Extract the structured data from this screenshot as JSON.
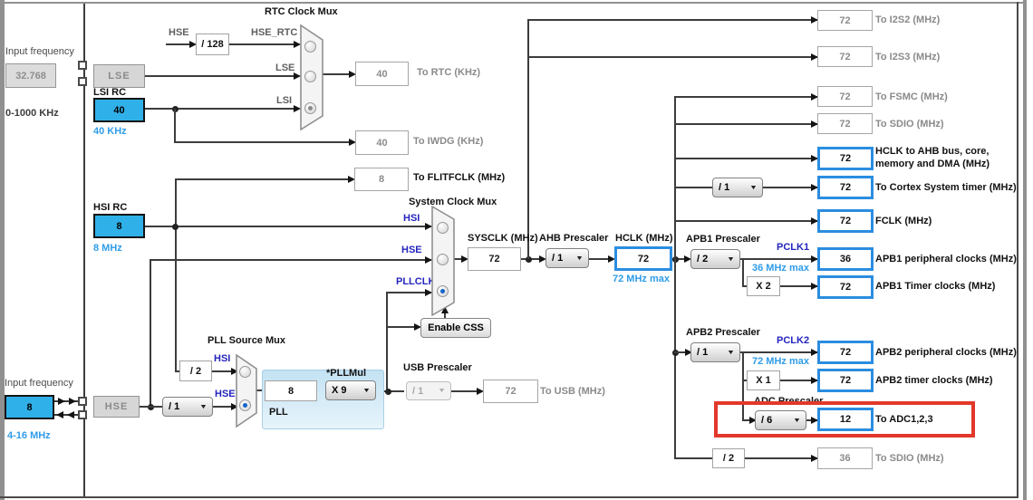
{
  "meta": {
    "caret_icon": "▼",
    "accent_blue": "#2b8de0",
    "cyan_fill": "#30b0e8",
    "highlight_red": "#e2382b"
  },
  "left": {
    "lse_input_label": "Input frequency",
    "lse_input_value": "32.768",
    "lse_input_range": "0-1000 KHz",
    "lse_label": "LSE",
    "lsi_title": "LSI RC",
    "lsi_value": "40",
    "lsi_note": "40 KHz",
    "hsi_title": "HSI RC",
    "hsi_value": "8",
    "hsi_note": "8 MHz",
    "hse_input_label": "Input frequency",
    "hse_input_value": "8",
    "hse_input_range": "4-16 MHz",
    "hse_label": "HSE"
  },
  "rtc": {
    "title": "RTC Clock Mux",
    "hse_tap": "HSE",
    "div128": "/ 128",
    "net_hse_rtc": "HSE_RTC",
    "net_lse": "LSE",
    "net_lsi": "LSI",
    "to_rtc_value": "40",
    "to_rtc_label": "To RTC (KHz)",
    "to_iwdg_value": "40",
    "to_iwdg_label": "To IWDG (KHz)",
    "to_flitf_value": "8",
    "to_flitf_label": "To FLITFCLK (MHz)"
  },
  "sysmux": {
    "title": "System Clock Mux",
    "net_hsi": "HSI",
    "net_hse": "HSE",
    "net_pllclk": "PLLCLK",
    "enable_css": "Enable CSS",
    "sysclk_title": "SYSCLK (MHz)",
    "sysclk_value": "72",
    "ahb_title": "AHB Prescaler",
    "ahb_value": "/ 1",
    "hclk_title": "HCLK (MHz)",
    "hclk_value": "72",
    "hclk_note": "72 MHz max"
  },
  "pll": {
    "title": "PLL Source Mux",
    "div2": "/ 2",
    "div1": "/ 1",
    "net_hsi": "HSI",
    "net_hse": "HSE",
    "input_value": "8",
    "pllmul_title": "*PLLMul",
    "pllmul_value": "X 9",
    "block_label": "PLL",
    "usb_title": "USB Prescaler",
    "usb_presc": "/ 1",
    "usb_value": "72",
    "usb_label": "To USB (MHz)"
  },
  "right": {
    "i2s2": {
      "value": "72",
      "label": "To I2S2 (MHz)"
    },
    "i2s3": {
      "value": "72",
      "label": "To I2S3 (MHz)"
    },
    "fsmc": {
      "value": "72",
      "label": "To FSMC (MHz)"
    },
    "sdio": {
      "value": "72",
      "label": "To SDIO (MHz)"
    },
    "hclk_ahb": {
      "value": "72",
      "label1": "HCLK to AHB bus, core,",
      "label2": "memory and DMA (MHz)"
    },
    "cortex": {
      "presc": "/ 1",
      "value": "72",
      "label": "To Cortex System timer (MHz)"
    },
    "fclk": {
      "value": "72",
      "label": "FCLK (MHz)"
    },
    "apb1": {
      "title": "APB1 Prescaler",
      "presc": "/ 2",
      "net": "PCLK1",
      "note": "36 MHz max",
      "periph_value": "36",
      "periph_label": "APB1 peripheral clocks (MHz)",
      "mul": "X 2",
      "timer_value": "72",
      "timer_label": "APB1 Timer clocks (MHz)"
    },
    "apb2": {
      "title": "APB2 Prescaler",
      "presc": "/ 1",
      "net": "PCLK2",
      "note": "72 MHz max",
      "periph_value": "72",
      "periph_label": "APB2 peripheral clocks (MHz)",
      "mul": "X 1",
      "timer_value": "72",
      "timer_label": "APB2 timer clocks (MHz)"
    },
    "adc": {
      "title": "ADC Prescaler",
      "presc": "/ 6",
      "value": "12",
      "label": "To ADC1,2,3"
    },
    "sdio2": {
      "presc": "/ 2",
      "value": "36",
      "label": "To SDIO (MHz)"
    }
  }
}
